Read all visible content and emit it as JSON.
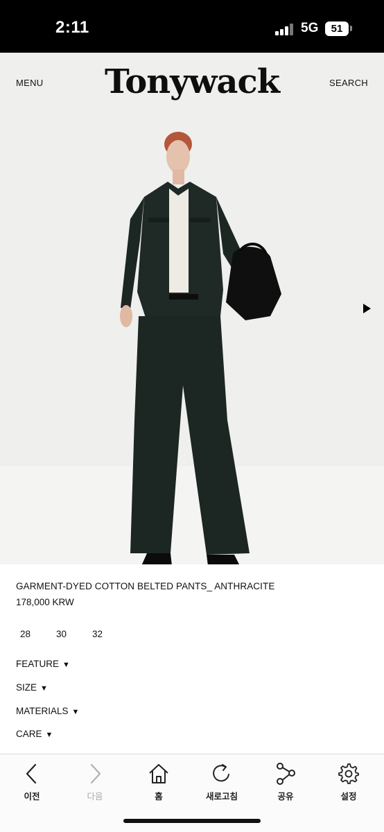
{
  "status_bar": {
    "time": "2:11",
    "network": "5G",
    "battery": "51"
  },
  "header": {
    "menu": "MENU",
    "brand": "Tonywack",
    "search": "SEARCH"
  },
  "product": {
    "name": "GARMENT-DYED COTTON BELTED PANTS_ ANTHRACITE",
    "price": "178,000 KRW",
    "sizes": [
      "28",
      "30",
      "32"
    ]
  },
  "sections": [
    {
      "label": "FEATURE"
    },
    {
      "label": "SIZE"
    },
    {
      "label": "MATERIALS"
    },
    {
      "label": "CARE"
    }
  ],
  "tabbar": {
    "items": [
      {
        "label": "이전",
        "icon": "back-icon",
        "enabled": true
      },
      {
        "label": "다음",
        "icon": "forward-icon",
        "enabled": false
      },
      {
        "label": "홈",
        "icon": "home-icon",
        "enabled": true
      },
      {
        "label": "새로고침",
        "icon": "refresh-icon",
        "enabled": true
      },
      {
        "label": "공유",
        "icon": "share-icon",
        "enabled": true
      },
      {
        "label": "설정",
        "icon": "gear-icon",
        "enabled": true
      }
    ]
  },
  "colors": {
    "outfit": "#1f2a27",
    "background": "#efefed",
    "accent": "#000000"
  }
}
